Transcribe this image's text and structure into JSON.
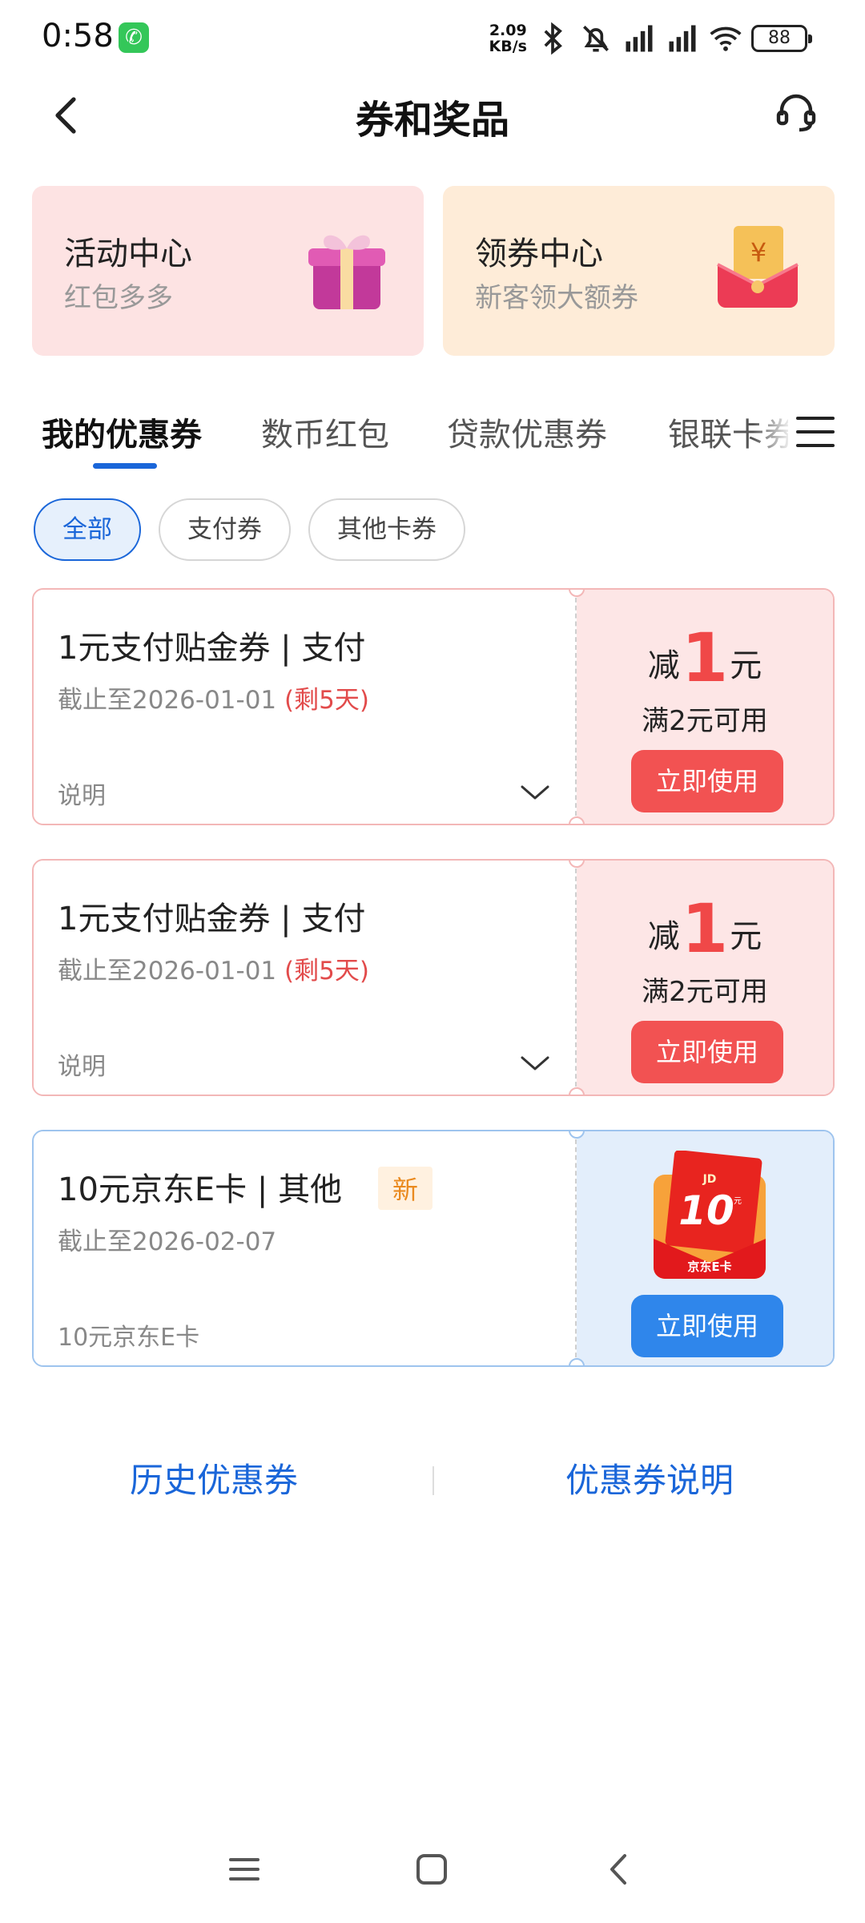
{
  "status_bar": {
    "time": "0:58",
    "net_speed_value": "2.09",
    "net_speed_unit": "KB/s",
    "battery": "88"
  },
  "header": {
    "title": "券和奖品"
  },
  "promo_cards": [
    {
      "title": "活动中心",
      "subtitle": "红包多多",
      "icon": "gift-box-icon"
    },
    {
      "title": "领券中心",
      "subtitle": "新客领大额券",
      "icon": "red-envelope-icon"
    }
  ],
  "tabs": [
    {
      "label": "我的优惠券",
      "active": true
    },
    {
      "label": "数币红包"
    },
    {
      "label": "贷款优惠券"
    },
    {
      "label": "银联卡券"
    }
  ],
  "filters": [
    {
      "label": "全部",
      "active": true
    },
    {
      "label": "支付券"
    },
    {
      "label": "其他卡券"
    }
  ],
  "coupons": [
    {
      "title": "1元支付贴金券 | 支付",
      "expiry": "截止至2026-01-01",
      "remaining": "(剩5天)",
      "desc": "说明",
      "prefix": "减",
      "amount": "1",
      "unit": "元",
      "condition": "满2元可用",
      "button": "立即使用"
    },
    {
      "title": "1元支付贴金券 | 支付",
      "expiry": "截止至2026-01-01",
      "remaining": "(剩5天)",
      "desc": "说明",
      "prefix": "减",
      "amount": "1",
      "unit": "元",
      "condition": "满2元可用",
      "button": "立即使用"
    },
    {
      "title": "10元京东E卡 |  其他",
      "badge": "新",
      "expiry": "截止至2026-02-07",
      "desc": "10元京东E卡",
      "card_brand": "JD",
      "card_value": "10",
      "card_unit": "元",
      "card_name": "京东E卡",
      "button": "立即使用"
    }
  ],
  "bottom_links": {
    "history": "历史优惠券",
    "rules": "优惠券说明"
  },
  "colors": {
    "accent": "#1a66d9",
    "coupon_red": "#f25252",
    "coupon_blue": "#2f86eb"
  }
}
